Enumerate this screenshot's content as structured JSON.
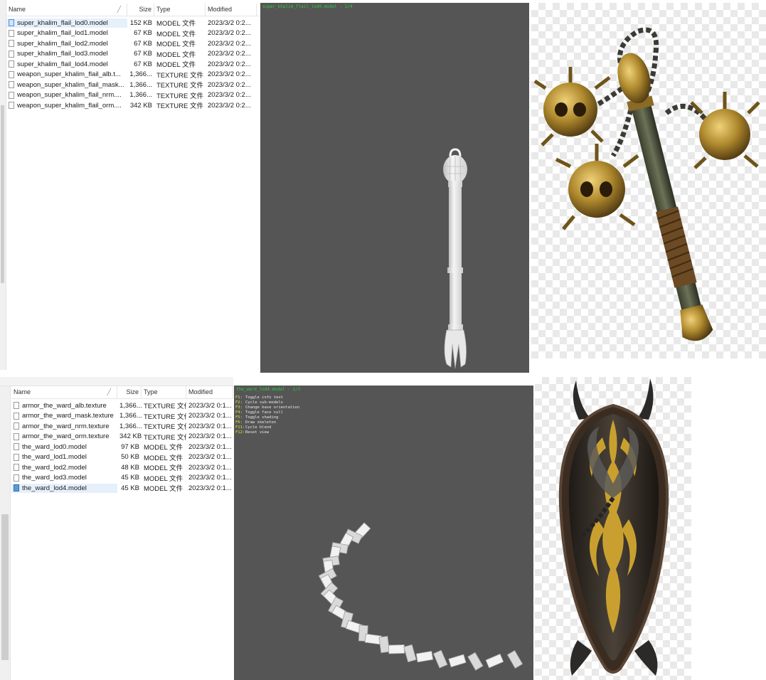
{
  "top_explorer": {
    "columns": [
      "Name",
      "Size",
      "Type",
      "Modified"
    ],
    "files": [
      {
        "name": "super_khalim_flail_lod0.model",
        "size": "152 KB",
        "type": "MODEL 文件",
        "modified": "2023/3/2 0:2...",
        "icon": "model-file-icon",
        "selected": true
      },
      {
        "name": "super_khalim_flail_lod1.model",
        "size": "67 KB",
        "type": "MODEL 文件",
        "modified": "2023/3/2 0:2...",
        "icon": "model-file-icon",
        "selected": false
      },
      {
        "name": "super_khalim_flail_lod2.model",
        "size": "67 KB",
        "type": "MODEL 文件",
        "modified": "2023/3/2 0:2...",
        "icon": "model-file-icon",
        "selected": false
      },
      {
        "name": "super_khalim_flail_lod3.model",
        "size": "67 KB",
        "type": "MODEL 文件",
        "modified": "2023/3/2 0:2...",
        "icon": "model-file-icon",
        "selected": false
      },
      {
        "name": "super_khalim_flail_lod4.model",
        "size": "67 KB",
        "type": "MODEL 文件",
        "modified": "2023/3/2 0:2...",
        "icon": "model-file-icon",
        "selected": false
      },
      {
        "name": "weapon_super_khalim_flail_alb.t...",
        "size": "1,366...",
        "type": "TEXTURE 文件",
        "modified": "2023/3/2 0:2...",
        "icon": "texture-file-icon",
        "selected": false
      },
      {
        "name": "weapon_super_khalim_flail_mask...",
        "size": "1,366...",
        "type": "TEXTURE 文件",
        "modified": "2023/3/2 0:2...",
        "icon": "texture-file-icon",
        "selected": false
      },
      {
        "name": "weapon_super_khalim_flail_nrm....",
        "size": "1,366...",
        "type": "TEXTURE 文件",
        "modified": "2023/3/2 0:2...",
        "icon": "texture-file-icon",
        "selected": false
      },
      {
        "name": "weapon_super_khalim_flail_orm....",
        "size": "342 KB",
        "type": "TEXTURE 文件",
        "modified": "2023/3/2 0:2...",
        "icon": "texture-file-icon",
        "selected": false
      }
    ]
  },
  "top_viewer": {
    "title": "super_khalim_flail_lod0.model - 1/4",
    "model_icon": "flail-model-icon"
  },
  "top_texture": {
    "icon": "flail-texture-icon"
  },
  "bottom_explorer": {
    "columns": [
      "Name",
      "Size",
      "Type",
      "Modified"
    ],
    "files": [
      {
        "name": "armor_the_ward_alb.texture",
        "size": "1,366...",
        "type": "TEXTURE 文件",
        "modified": "2023/3/2 0:1...",
        "icon": "texture-file-icon",
        "selected": false
      },
      {
        "name": "armor_the_ward_mask.texture",
        "size": "1,366...",
        "type": "TEXTURE 文件",
        "modified": "2023/3/2 0:1...",
        "icon": "texture-file-icon",
        "selected": false
      },
      {
        "name": "armor_the_ward_nrm.texture",
        "size": "1,366...",
        "type": "TEXTURE 文件",
        "modified": "2023/3/2 0:1...",
        "icon": "texture-file-icon",
        "selected": false
      },
      {
        "name": "armor_the_ward_orm.texture",
        "size": "342 KB",
        "type": "TEXTURE 文件",
        "modified": "2023/3/2 0:1...",
        "icon": "texture-file-icon",
        "selected": false
      },
      {
        "name": "the_ward_lod0.model",
        "size": "97 KB",
        "type": "MODEL 文件",
        "modified": "2023/3/2 0:1...",
        "icon": "model-file-icon",
        "selected": false
      },
      {
        "name": "the_ward_lod1.model",
        "size": "50 KB",
        "type": "MODEL 文件",
        "modified": "2023/3/2 0:1...",
        "icon": "model-file-icon",
        "selected": false
      },
      {
        "name": "the_ward_lod2.model",
        "size": "48 KB",
        "type": "MODEL 文件",
        "modified": "2023/3/2 0:1...",
        "icon": "model-file-icon",
        "selected": false
      },
      {
        "name": "the_ward_lod3.model",
        "size": "45 KB",
        "type": "MODEL 文件",
        "modified": "2023/3/2 0:1...",
        "icon": "model-file-icon",
        "selected": false
      },
      {
        "name": "the_ward_lod4.model",
        "size": "45 KB",
        "type": "MODEL 文件",
        "modified": "2023/3/2 0:1...",
        "icon": "model-file-icon",
        "selected": true
      }
    ]
  },
  "bottom_viewer": {
    "title": "the_ward_lod4.model - 1/2",
    "model_icon": "chain-model-icon",
    "shortcuts": [
      {
        "key": "F1:",
        "desc": "Toggle info text"
      },
      {
        "key": "F2:",
        "desc": "Cycle sub-models"
      },
      {
        "key": "F3:",
        "desc": "Change base orientation"
      },
      {
        "key": "F4:",
        "desc": "Toggle face cull"
      },
      {
        "key": "F5:",
        "desc": "Toggle shading"
      },
      {
        "key": "F6:",
        "desc": "Draw skeleton"
      },
      {
        "key": "F11:",
        "desc": "Cycle blend"
      },
      {
        "key": "F12:",
        "desc": "Reset view"
      }
    ]
  },
  "bottom_texture": {
    "icon": "shield-texture-icon"
  },
  "colors": {
    "viewer_bg": "#555555",
    "viewer_title": "#2ecc40",
    "shortcut_key": "#e0e040",
    "selection": "#e5f0fb"
  }
}
